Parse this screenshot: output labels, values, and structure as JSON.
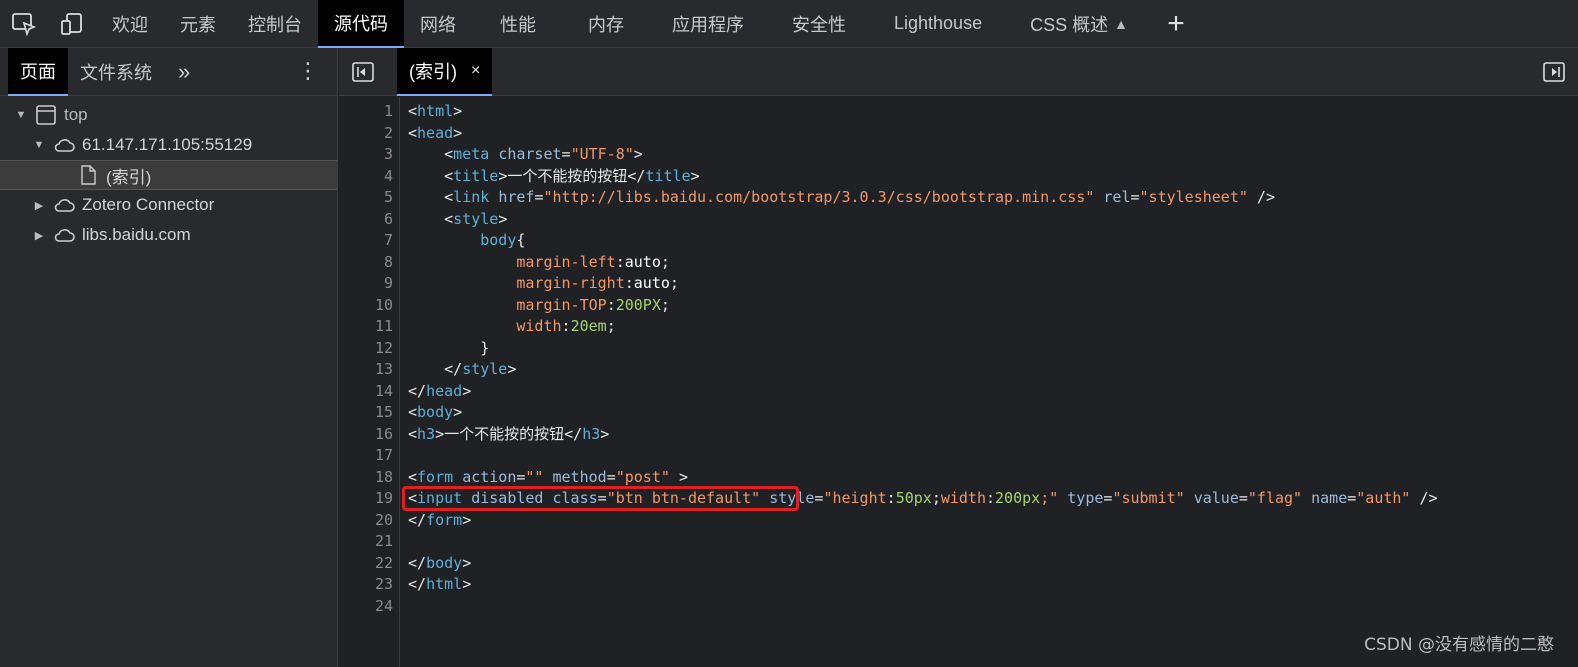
{
  "top_tabs": [
    "欢迎",
    "元素",
    "控制台",
    "源代码",
    "网络",
    "性能",
    "内存",
    "应用程序",
    "安全性",
    "Lighthouse",
    "CSS 概述"
  ],
  "top_tab_active": "源代码",
  "left_tabs": {
    "page": "页面",
    "filesystem": "文件系统"
  },
  "tree": {
    "top": "top",
    "host": "61.147.171.105:55129",
    "index": "(索引)",
    "zotero": "Zotero Connector",
    "baidu": "libs.baidu.com"
  },
  "editor_tab": {
    "label": "(索引)",
    "close": "×"
  },
  "line_numbers": [
    "1",
    "2",
    "3",
    "4",
    "5",
    "6",
    "7",
    "8",
    "9",
    "10",
    "11",
    "12",
    "13",
    "14",
    "15",
    "16",
    "17",
    "18",
    "19",
    "20",
    "21",
    "22",
    "23",
    "24"
  ],
  "code": {
    "l1_open": "<",
    "l1_tag": "html",
    "l1_close": ">",
    "l3_attr": "charset",
    "l3_val": "\"UTF-8\"",
    "l4_text": "一个不能按的按钮",
    "l5_href": "href",
    "l5_url": "\"http://libs.baidu.com/bootstrap/3.0.3/css/bootstrap.min.css\"",
    "l5_rel": "rel",
    "l5_relv": "\"stylesheet\"",
    "l7_sel": "body",
    "l8_prop": "margin-left",
    "l8_val": "auto",
    "l9_prop": "margin-right",
    "l9_val": "auto",
    "l10_prop": "margin-TOP",
    "l10_val": "200PX",
    "l11_prop": "width",
    "l11_val": "20em",
    "l16_text": "一个不能按的按钮",
    "l18_action": "\"\"",
    "l18_method": "\"post\"",
    "l19_class": "\"btn btn-default\"",
    "l19_style_a": "\"height",
    "l19_style_b": "50px",
    "l19_style_c": "width",
    "l19_style_d": "200px",
    "l19_type": "\"submit\"",
    "l19_value": "\"flag\"",
    "l19_name": "\"auth\""
  },
  "watermark": "CSDN @没有感情的二憨",
  "colors": {
    "highlight_box": "#e02020",
    "accent": "#7cacf8"
  }
}
